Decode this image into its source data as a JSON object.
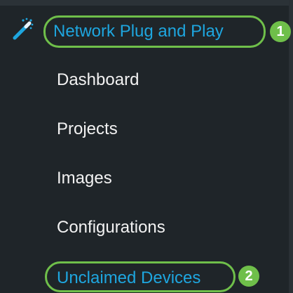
{
  "menu": {
    "title": "Network Plug and Play",
    "items": [
      {
        "label": "Dashboard"
      },
      {
        "label": "Projects"
      },
      {
        "label": "Images"
      },
      {
        "label": "Configurations"
      },
      {
        "label": "Unclaimed Devices"
      }
    ]
  },
  "annotations": {
    "badge_1": "1",
    "badge_2": "2"
  },
  "icons": {
    "header": "magic-wand-icon"
  },
  "colors": {
    "background": "#1f2529",
    "link": "#1ea6df",
    "text": "#f2f2f2",
    "highlight": "#6fbf4a"
  }
}
